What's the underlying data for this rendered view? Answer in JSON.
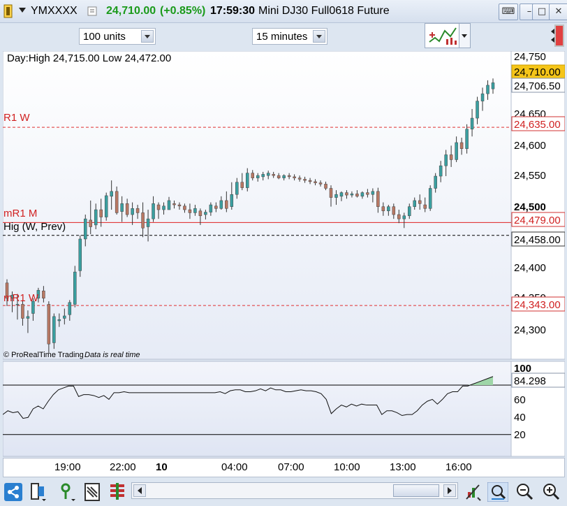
{
  "window": {
    "symbol": "YMXXXX",
    "last_price": "24,710.00",
    "change": "(+0.85%)",
    "time": "17:59:30",
    "instrument_name": "Mini DJ30 Full0618 Future"
  },
  "toolbar": {
    "units_select": "100 units",
    "timeframe_select": "15 minutes"
  },
  "price_chart": {
    "info_text": "Day:High 24,715.00 Low 24,472.00",
    "watermark": "© ProRealTime Trading",
    "realtime_note": "Data is real time",
    "level_labels": [
      "R1 W",
      "mR1 M",
      "Hig (W, Prev)",
      "mR1 W"
    ],
    "price_badges": [
      "24,710.00",
      "24,706.50",
      "24,635.00",
      "24,479.00",
      "24,458.00",
      "24,343.00"
    ],
    "axis_labels": [
      "24,750",
      "24,650",
      "24,600",
      "24,550",
      "24,500",
      "24,400",
      "24,350",
      "24,300"
    ]
  },
  "indicator": {
    "value_badge": "84.298",
    "axis_labels": [
      "100",
      "60",
      "40",
      "20"
    ]
  },
  "time_axis": {
    "labels": [
      "19:00",
      "22:00",
      "10",
      "04:00",
      "07:00",
      "10:00",
      "13:00",
      "16:00"
    ]
  },
  "colors": {
    "up_candle": "#3a9fa0",
    "down_candle": "#b87864",
    "r1w_line": "#e03030",
    "mr1m_line": "#e02020",
    "prev_high_line": "#000000",
    "gain_text": "#1a9a1a",
    "last_price_badge": "#f5c518"
  },
  "chart_data": [
    {
      "type": "candlestick",
      "title": "",
      "ylim": [
        24255,
        24760
      ],
      "levels": [
        {
          "name": "R1 W",
          "value": 24635
        },
        {
          "name": "mR1 M",
          "value": 24479
        },
        {
          "name": "Hig (W, Prev)",
          "value": 24458
        },
        {
          "name": "mR1 W",
          "value": 24343
        }
      ],
      "ohlc": [
        [
          24380,
          24386,
          24342,
          24355
        ],
        [
          24355,
          24366,
          24332,
          24360
        ],
        [
          24345,
          24362,
          24320,
          24345
        ],
        [
          24345,
          24352,
          24310,
          24322
        ],
        [
          24322,
          24335,
          24298,
          24325
        ],
        [
          24330,
          24355,
          24318,
          24350
        ],
        [
          24355,
          24372,
          24348,
          24368
        ],
        [
          24367,
          24375,
          24348,
          24355
        ],
        [
          24345,
          24350,
          24265,
          24280
        ],
        [
          24282,
          24330,
          24272,
          24325
        ],
        [
          24318,
          24330,
          24308,
          24320
        ],
        [
          24322,
          24338,
          24312,
          24326
        ],
        [
          24328,
          24352,
          24318,
          24348
        ],
        [
          24345,
          24408,
          24340,
          24398
        ],
        [
          24400,
          24458,
          24390,
          24452
        ],
        [
          24452,
          24492,
          24440,
          24485
        ],
        [
          24483,
          24515,
          24460,
          24472
        ],
        [
          24475,
          24510,
          24468,
          24500
        ],
        [
          24500,
          24518,
          24472,
          24488
        ],
        [
          24488,
          24528,
          24482,
          24523
        ],
        [
          24522,
          24548,
          24500,
          24530
        ],
        [
          24530,
          24538,
          24492,
          24495
        ],
        [
          24497,
          24522,
          24480,
          24510
        ],
        [
          24510,
          24518,
          24488,
          24492
        ],
        [
          24492,
          24512,
          24475,
          24502
        ],
        [
          24502,
          24508,
          24485,
          24495
        ],
        [
          24495,
          24512,
          24455,
          24470
        ],
        [
          24472,
          24500,
          24448,
          24485
        ],
        [
          24485,
          24522,
          24480,
          24510
        ],
        [
          24508,
          24512,
          24485,
          24500
        ],
        [
          24500,
          24512,
          24492,
          24506
        ],
        [
          24500,
          24521,
          24500,
          24515
        ],
        [
          24510,
          24515,
          24502,
          24508
        ],
        [
          24508,
          24512,
          24500,
          24506
        ],
        [
          24506,
          24510,
          24495,
          24500
        ],
        [
          24500,
          24510,
          24485,
          24495
        ],
        [
          24495,
          24508,
          24490,
          24502
        ],
        [
          24498,
          24502,
          24475,
          24490
        ],
        [
          24492,
          24500,
          24484,
          24496
        ],
        [
          24496,
          24512,
          24490,
          24508
        ],
        [
          24506,
          24512,
          24496,
          24502
        ],
        [
          24502,
          24522,
          24500,
          24515
        ],
        [
          24515,
          24530,
          24496,
          24502
        ],
        [
          24505,
          24545,
          24500,
          24525
        ],
        [
          24525,
          24552,
          24518,
          24545
        ],
        [
          24545,
          24560,
          24532,
          24536
        ],
        [
          24536,
          24568,
          24530,
          24560
        ],
        [
          24560,
          24565,
          24548,
          24552
        ],
        [
          24552,
          24560,
          24546,
          24556
        ],
        [
          24554,
          24562,
          24548,
          24558
        ],
        [
          24556,
          24564,
          24550,
          24560
        ],
        [
          24558,
          24562,
          24552,
          24556
        ],
        [
          24556,
          24560,
          24550,
          24552
        ],
        [
          24552,
          24558,
          24548,
          24556
        ],
        [
          24556,
          24560,
          24550,
          24554
        ],
        [
          24554,
          24558,
          24548,
          24552
        ],
        [
          24552,
          24556,
          24546,
          24550
        ],
        [
          24550,
          24554,
          24544,
          24548
        ],
        [
          24548,
          24552,
          24542,
          24546
        ],
        [
          24546,
          24550,
          24540,
          24544
        ],
        [
          24544,
          24548,
          24538,
          24542
        ],
        [
          24542,
          24546,
          24532,
          24535
        ],
        [
          24535,
          24540,
          24505,
          24520
        ],
        [
          24520,
          24532,
          24508,
          24525
        ],
        [
          24522,
          24530,
          24514,
          24528
        ],
        [
          24528,
          24532,
          24518,
          24524
        ],
        [
          24524,
          24530,
          24520,
          24526
        ],
        [
          24526,
          24532,
          24520,
          24522
        ],
        [
          24522,
          24530,
          24518,
          24528
        ],
        [
          24528,
          24534,
          24520,
          24525
        ],
        [
          24525,
          24535,
          24512,
          24530
        ],
        [
          24530,
          24536,
          24495,
          24505
        ],
        [
          24505,
          24512,
          24490,
          24498
        ],
        [
          24498,
          24508,
          24490,
          24505
        ],
        [
          24505,
          24510,
          24485,
          24492
        ],
        [
          24492,
          24500,
          24478,
          24485
        ],
        [
          24485,
          24495,
          24470,
          24490
        ],
        [
          24490,
          24510,
          24485,
          24505
        ],
        [
          24505,
          24520,
          24500,
          24515
        ],
        [
          24515,
          24525,
          24500,
          24510
        ],
        [
          24508,
          24520,
          24496,
          24502
        ],
        [
          24502,
          24540,
          24498,
          24535
        ],
        [
          24535,
          24560,
          24528,
          24555
        ],
        [
          24555,
          24580,
          24545,
          24572
        ],
        [
          24572,
          24598,
          24555,
          24590
        ],
        [
          24590,
          24605,
          24570,
          24582
        ],
        [
          24582,
          24620,
          24578,
          24610
        ],
        [
          24610,
          24618,
          24590,
          24600
        ],
        [
          24600,
          24640,
          24592,
          24632
        ],
        [
          24632,
          24665,
          24620,
          24650
        ],
        [
          24650,
          24685,
          24640,
          24678
        ],
        [
          24678,
          24700,
          24662,
          24690
        ],
        [
          24690,
          24712,
          24680,
          24704
        ],
        [
          24698,
          24715,
          24690,
          24708
        ]
      ]
    },
    {
      "type": "line",
      "title": "",
      "ylim": [
        0,
        100
      ],
      "ytick_labels": [
        "100",
        "60",
        "40",
        "20"
      ],
      "overbought": 75,
      "oversold": 23,
      "values": [
        44,
        48,
        46,
        47,
        40,
        41,
        50,
        53,
        50,
        58,
        65,
        70,
        72,
        74,
        74,
        63,
        65,
        65,
        64,
        62,
        64,
        60,
        67,
        67,
        68,
        67,
        67,
        67,
        67,
        67,
        67,
        67,
        67,
        67,
        67,
        67,
        67,
        67,
        67,
        67,
        67,
        67,
        67,
        68,
        66,
        69,
        70,
        70,
        68,
        68,
        69,
        71,
        69,
        72,
        70,
        70,
        68,
        68,
        69,
        70,
        69,
        69,
        68,
        66,
        60,
        45,
        50,
        54,
        52,
        55,
        53,
        55,
        54,
        54,
        54,
        44,
        48,
        48,
        46,
        43,
        44,
        44,
        48,
        54,
        58,
        60,
        55,
        60,
        66,
        68,
        68,
        74,
        74,
        76,
        78,
        80,
        82,
        84
      ]
    }
  ]
}
